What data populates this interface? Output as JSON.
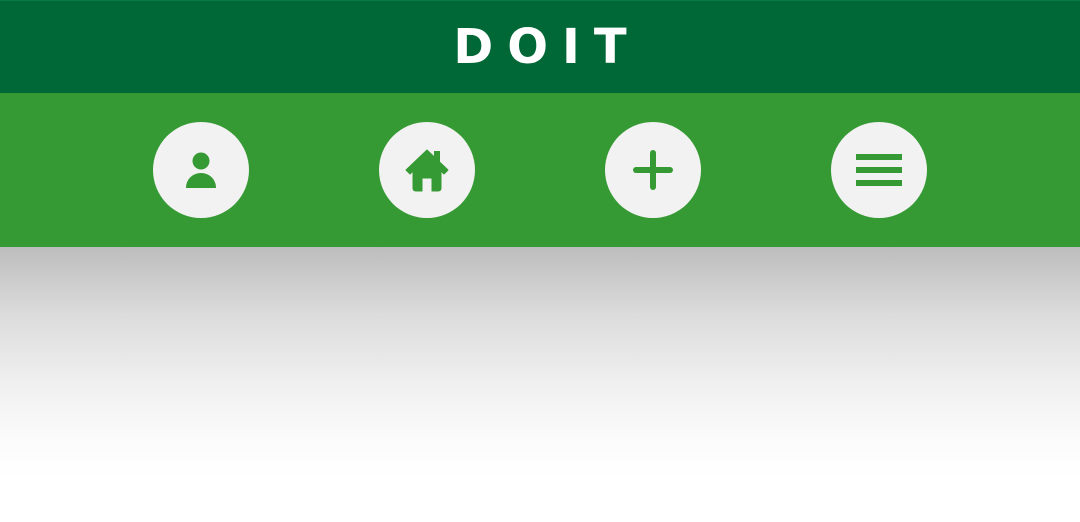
{
  "header": {
    "title": "DOIT"
  },
  "nav": {
    "buttons": [
      {
        "icon": "person-icon"
      },
      {
        "icon": "home-icon"
      },
      {
        "icon": "plus-icon"
      },
      {
        "icon": "menu-icon"
      }
    ]
  },
  "colors": {
    "header_bg": "#006837",
    "nav_bg": "#359a33",
    "button_bg": "#f2f2f2",
    "icon_color": "#359a33",
    "title_color": "#ffffff"
  }
}
